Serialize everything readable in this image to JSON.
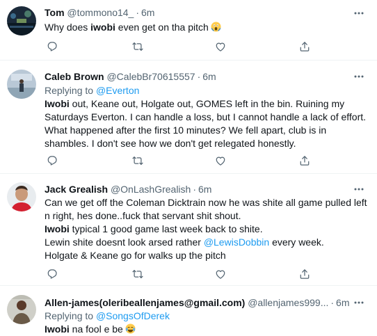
{
  "tweets": [
    {
      "name": "Tom",
      "handle": "@tommono14_",
      "time": "6m",
      "text_1": "Why does ",
      "highlight": "iwobi",
      "text_2": " even get on tha pitch",
      "emoji": "screaming-face"
    },
    {
      "name": "Caleb Brown",
      "handle": "@CalebBr70615557",
      "time": "6m",
      "replying_label": "Replying to",
      "replying_to": "@Everton",
      "highlight": "Iwobi",
      "text_1": " out, Keane out, Holgate out, GOMES left in the bin. Ruining my",
      "line_2": "Saturdays Everton. I can handle a loss, but I cannot handle a lack of effort.",
      "line_3": "What happened after the first 10 minutes? We fell apart, club is in",
      "line_4": "shambles. I don't see how we don't get relegated honestly."
    },
    {
      "name": "Jack Grealish",
      "handle": "@OnLashGrealish",
      "time": "6m",
      "line_1": "Can we get off the Coleman Dicktrain now he was shite all game pulled left",
      "line_2": "n right, hes done..fuck that servant shit shout.",
      "highlight": "Iwobi",
      "line_3_rest": " typical 1 good game last week back to shite.",
      "line_4_a": "Lewin shite doesnt look arsed rather ",
      "mention": "@LewisDobbin",
      "line_4_b": " every week.",
      "line_5": "Holgate & Keane go for walks up the pitch"
    },
    {
      "name": "Allen-james(oleribeallenjames@gmail.com)",
      "handle": "@allenjames999...",
      "time": "6m",
      "replying_label": "Replying to",
      "replying_to": "@SongsOfDerek",
      "highlight": "Iwobi",
      "text_1": " na fool e be",
      "emoji": "tears-of-joy"
    }
  ],
  "icons": [
    "reply-icon",
    "retweet-icon",
    "like-icon",
    "share-icon",
    "more-icon"
  ],
  "colors": {
    "accent": "#1d9bf0",
    "secondary_text": "#536471",
    "divider": "#eff3f4"
  }
}
